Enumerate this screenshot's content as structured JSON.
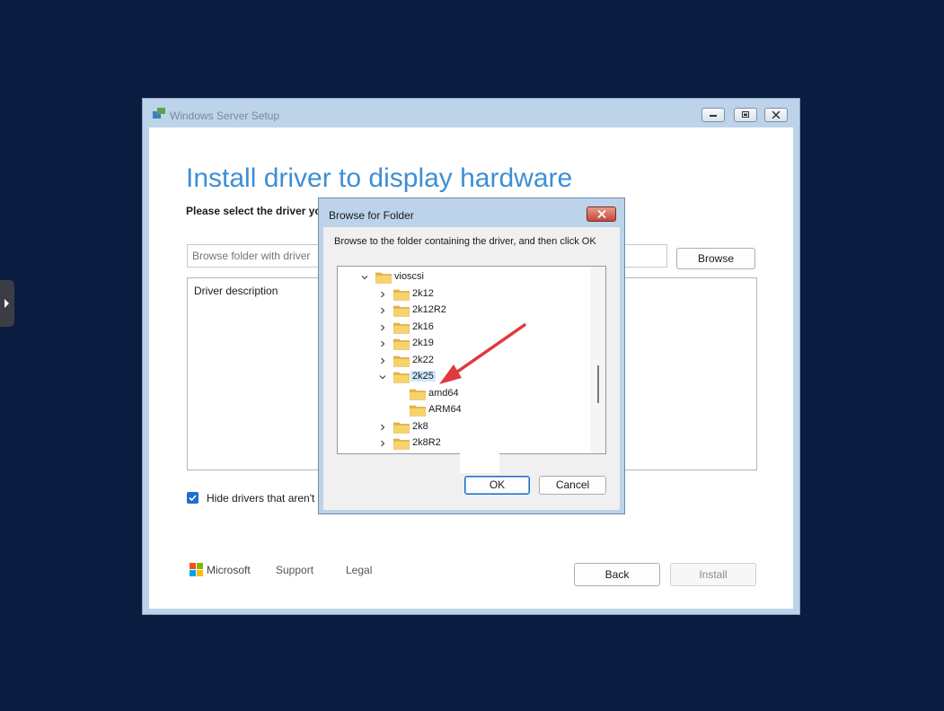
{
  "setup": {
    "title": "Windows Server Setup",
    "heading": "Install driver to display hardware",
    "subtext": "Please select the driver you",
    "folder_placeholder": "Browse folder with driver",
    "browse_label": "Browse",
    "description_label": "Driver description",
    "hide_label": "Hide drivers that aren't",
    "hide_checked": true,
    "footer": {
      "brand": "Microsoft",
      "support": "Support",
      "legal": "Legal"
    },
    "back_label": "Back",
    "install_label": "Install"
  },
  "dialog": {
    "title": "Browse for Folder",
    "instruction": "Browse to the folder containing the driver, and then click OK",
    "tree": [
      {
        "label": "vioscsi",
        "state": "expanded",
        "depth": 0
      },
      {
        "label": "2k12",
        "state": "collapsed",
        "depth": 1
      },
      {
        "label": "2k12R2",
        "state": "collapsed",
        "depth": 1
      },
      {
        "label": "2k16",
        "state": "collapsed",
        "depth": 1
      },
      {
        "label": "2k19",
        "state": "collapsed",
        "depth": 1
      },
      {
        "label": "2k22",
        "state": "collapsed",
        "depth": 1
      },
      {
        "label": "2k25",
        "state": "expanded",
        "depth": 1,
        "selected": true
      },
      {
        "label": "amd64",
        "state": "leaf",
        "depth": 2
      },
      {
        "label": "ARM64",
        "state": "leaf",
        "depth": 2
      },
      {
        "label": "2k8",
        "state": "collapsed",
        "depth": 1
      },
      {
        "label": "2k8R2",
        "state": "collapsed",
        "depth": 1
      }
    ],
    "ok_label": "OK",
    "cancel_label": "Cancel"
  },
  "colors": {
    "desktop": "#0b1c40",
    "heading_blue": "#3d8fd6",
    "annotation_arrow": "#e0393e",
    "selection": "#cde8ff"
  }
}
